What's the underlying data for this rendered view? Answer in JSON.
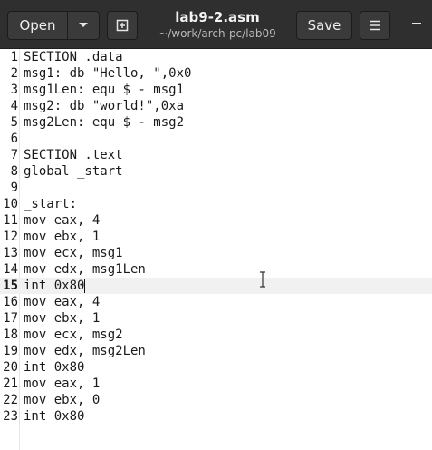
{
  "header": {
    "open_label": "Open",
    "save_label": "Save",
    "title": "lab9-2.asm",
    "subtitle": "~/work/arch-pc/lab09"
  },
  "icons": {
    "open_menu": "chevron-down-icon",
    "new_tab": "new-document-icon",
    "hamburger": "hamburger-menu-icon",
    "minimize": "minimize-icon"
  },
  "editor": {
    "current_line": 15,
    "lines": [
      {
        "num": "1",
        "text": "SECTION .data"
      },
      {
        "num": "2",
        "text": "msg1: db \"Hello, \",0x0"
      },
      {
        "num": "3",
        "text": "msg1Len: equ $ - msg1"
      },
      {
        "num": "4",
        "text": "msg2: db \"world!\",0xa"
      },
      {
        "num": "5",
        "text": "msg2Len: equ $ - msg2"
      },
      {
        "num": "6",
        "text": ""
      },
      {
        "num": "7",
        "text": "SECTION .text"
      },
      {
        "num": "8",
        "text": "global _start"
      },
      {
        "num": "9",
        "text": ""
      },
      {
        "num": "10",
        "text": "_start:"
      },
      {
        "num": "11",
        "text": "mov eax, 4"
      },
      {
        "num": "12",
        "text": "mov ebx, 1"
      },
      {
        "num": "13",
        "text": "mov ecx, msg1"
      },
      {
        "num": "14",
        "text": "mov edx, msg1Len"
      },
      {
        "num": "15",
        "text": "int 0x80"
      },
      {
        "num": "16",
        "text": "mov eax, 4"
      },
      {
        "num": "17",
        "text": "mov ebx, 1"
      },
      {
        "num": "18",
        "text": "mov ecx, msg2"
      },
      {
        "num": "19",
        "text": "mov edx, msg2Len"
      },
      {
        "num": "20",
        "text": "int 0x80"
      },
      {
        "num": "21",
        "text": "mov eax, 1"
      },
      {
        "num": "22",
        "text": "mov ebx, 0"
      },
      {
        "num": "23",
        "text": "int 0x80"
      }
    ]
  }
}
